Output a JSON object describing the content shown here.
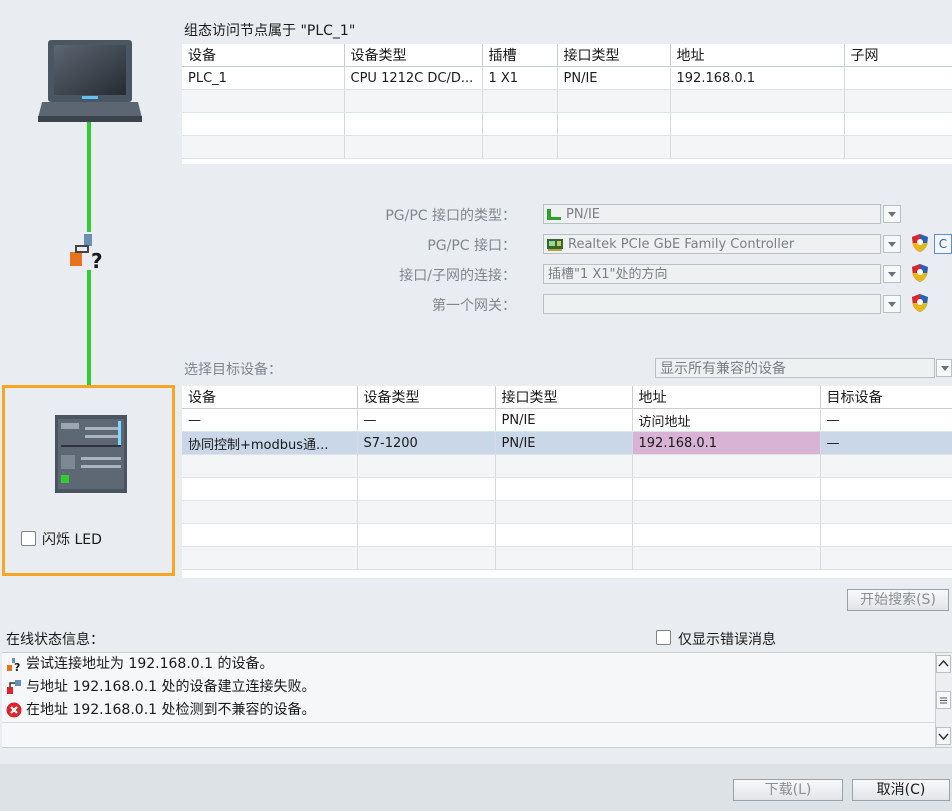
{
  "node_title": "组态访问节点属于 \"PLC_1\"",
  "config_table": {
    "headers": [
      "设备",
      "设备类型",
      "插槽",
      "接口类型",
      "地址",
      "子网"
    ],
    "rows": [
      [
        "PLC_1",
        "CPU 1212C DC/D...",
        "1 X1",
        "PN/IE",
        "192.168.0.1",
        ""
      ]
    ]
  },
  "pgpc": {
    "type_label": "PG/PC 接口的类型：",
    "type_value": "PN/IE",
    "iface_label": "PG/PC 接口：",
    "iface_value": "Realtek PCIe GbE Family Controller",
    "conn_label": "接口/子网的连接：",
    "conn_value": "插槽\"1 X1\"处的方向",
    "gateway_label": "第一个网关：",
    "gateway_value": ""
  },
  "target": {
    "label": "选择目标设备：",
    "filter_value": "显示所有兼容的设备",
    "headers": [
      "设备",
      "设备类型",
      "接口类型",
      "地址",
      "目标设备"
    ],
    "rows": [
      [
        "—",
        "—",
        "PN/IE",
        "访问地址",
        "—"
      ],
      [
        "协同控制+modbus通...",
        "S7-1200",
        "PN/IE",
        "192.168.0.1",
        "—"
      ]
    ]
  },
  "flash_led_label": "闪烁 LED",
  "start_search_label": "开始搜索(S)",
  "status": {
    "label": "在线状态信息：",
    "errors_only_label": "仅显示错误消息",
    "messages": [
      {
        "icon": "network-question-icon",
        "text": "尝试连接地址为 192.168.0.1 的设备。"
      },
      {
        "icon": "network-fail-icon",
        "text": "与地址 192.168.0.1 处的设备建立连接失败。"
      },
      {
        "icon": "error-circle-icon",
        "text": "在地址 192.168.0.1 处检测到不兼容的设备。"
      }
    ]
  },
  "footer": {
    "load_label": "下载(L)",
    "cancel_label": "取消(C)"
  },
  "colors": {
    "link_line": "#33cc33",
    "highlight_border": "#f5a623",
    "selected_row": "#c9d7e8",
    "address_highlight": "#d9b3d6",
    "error_red": "#d9252b"
  }
}
